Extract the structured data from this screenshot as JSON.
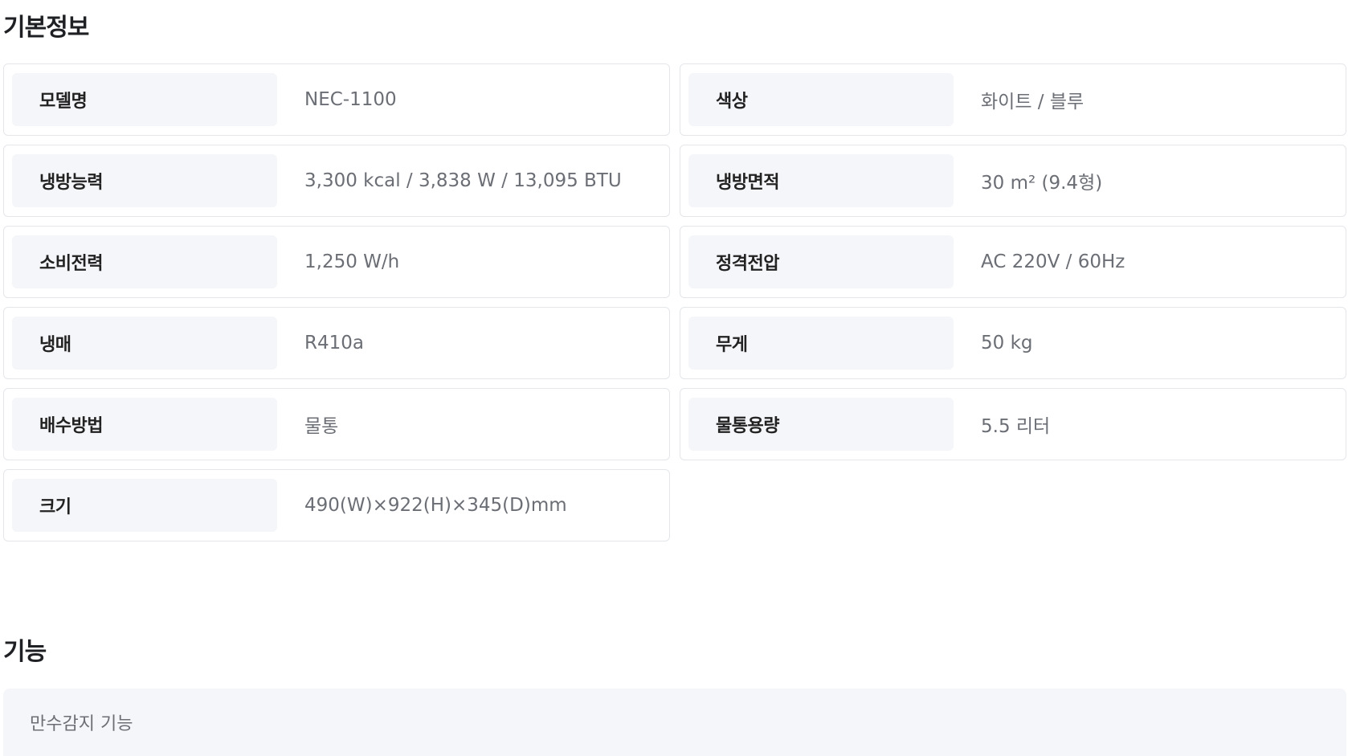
{
  "basic": {
    "title": "기본정보",
    "specs": [
      {
        "label": "모델명",
        "value": "NEC-1100"
      },
      {
        "label": "색상",
        "value": "화이트 / 블루"
      },
      {
        "label": "냉방능력",
        "value": "3,300 kcal / 3,838 W / 13,095 BTU"
      },
      {
        "label": "냉방면적",
        "value": "30 m² (9.4형)"
      },
      {
        "label": "소비전력",
        "value": "1,250 W/h"
      },
      {
        "label": "정격전압",
        "value": "AC 220V / 60Hz"
      },
      {
        "label": "냉매",
        "value": "R410a"
      },
      {
        "label": "무게",
        "value": "50 kg"
      },
      {
        "label": "배수방법",
        "value": "물통"
      },
      {
        "label": "물통용량",
        "value": "5.5 리터"
      },
      {
        "label": "크기",
        "value": "490(W)×922(H)×345(D)mm"
      }
    ]
  },
  "features": {
    "title": "기능",
    "items": [
      "만수감지 기능"
    ]
  }
}
